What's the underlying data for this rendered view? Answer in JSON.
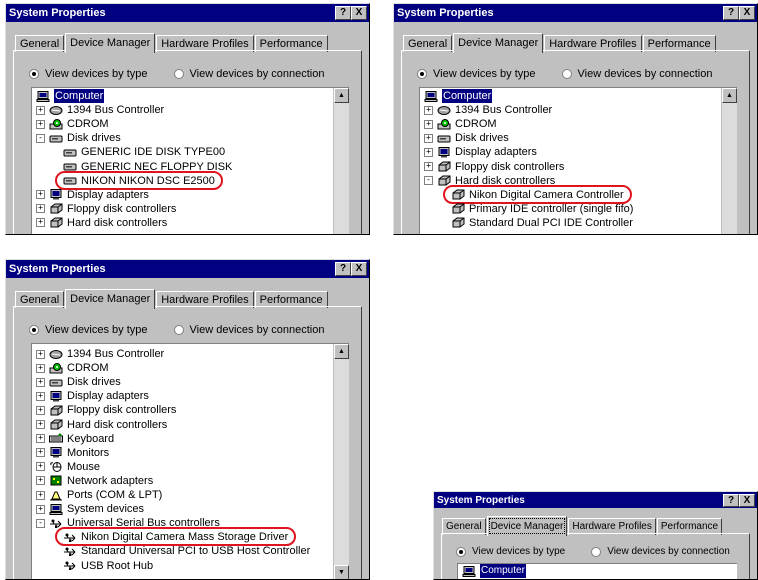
{
  "colors": {
    "titlebar": "#000080",
    "callout": "#e0141e",
    "window": "#c0c0c0"
  },
  "dialog": {
    "title": "System Properties",
    "help_label": "?",
    "close_label": "X",
    "tabs": [
      "General",
      "Device Manager",
      "Hardware Profiles",
      "Performance"
    ],
    "active_tab": "Device Manager",
    "view_by_type": "View devices by type",
    "view_by_connection": "View devices by connection"
  },
  "screens": [
    {
      "rows": [
        {
          "text": "Computer",
          "icon": "computer-icon",
          "selected": true
        },
        {
          "text": "1394 Bus Controller",
          "icon": "bus-icon",
          "toggle": "+"
        },
        {
          "text": "CDROM",
          "icon": "cdrom-icon",
          "toggle": "+"
        },
        {
          "text": "Disk drives",
          "icon": "disk-icon",
          "toggle": "-"
        },
        {
          "text": "GENERIC IDE  DISK TYPE00",
          "icon": "disk-icon"
        },
        {
          "text": "GENERIC NEC  FLOPPY DISK",
          "icon": "disk-icon"
        },
        {
          "text": "NIKON NIKON DSC E2500",
          "icon": "disk-icon",
          "circled": true
        },
        {
          "text": "Display adapters",
          "icon": "monitor-icon",
          "toggle": "+"
        },
        {
          "text": "Floppy disk controllers",
          "icon": "controller-icon",
          "toggle": "+"
        },
        {
          "text": "Hard disk controllers",
          "icon": "controller-icon",
          "toggle": "+"
        }
      ]
    },
    {
      "rows": [
        {
          "text": "Computer",
          "icon": "computer-icon",
          "selected": true
        },
        {
          "text": "1394 Bus Controller",
          "icon": "bus-icon",
          "toggle": "+"
        },
        {
          "text": "CDROM",
          "icon": "cdrom-icon",
          "toggle": "+"
        },
        {
          "text": "Disk drives",
          "icon": "disk-icon",
          "toggle": "+"
        },
        {
          "text": "Display adapters",
          "icon": "monitor-icon",
          "toggle": "+"
        },
        {
          "text": "Floppy disk controllers",
          "icon": "controller-icon",
          "toggle": "+"
        },
        {
          "text": "Hard disk controllers",
          "icon": "controller-icon",
          "toggle": "-"
        },
        {
          "text": "Nikon Digital Camera Controller",
          "icon": "controller-icon",
          "circled": true
        },
        {
          "text": "Primary IDE controller (single fifo)",
          "icon": "controller-icon"
        },
        {
          "text": "Standard Dual PCI IDE Controller",
          "icon": "controller-icon"
        }
      ]
    },
    {
      "rows": [
        {
          "text": "1394 Bus Controller",
          "icon": "bus-icon",
          "toggle": "+"
        },
        {
          "text": "CDROM",
          "icon": "cdrom-icon",
          "toggle": "+"
        },
        {
          "text": "Disk drives",
          "icon": "disk-icon",
          "toggle": "+"
        },
        {
          "text": "Display adapters",
          "icon": "monitor-icon",
          "toggle": "+"
        },
        {
          "text": "Floppy disk controllers",
          "icon": "controller-icon",
          "toggle": "+"
        },
        {
          "text": "Hard disk controllers",
          "icon": "controller-icon",
          "toggle": "+"
        },
        {
          "text": "Keyboard",
          "icon": "keyboard-icon",
          "toggle": "+"
        },
        {
          "text": "Monitors",
          "icon": "monitor-icon",
          "toggle": "+"
        },
        {
          "text": "Mouse",
          "icon": "mouse-icon",
          "toggle": "+"
        },
        {
          "text": "Network adapters",
          "icon": "network-icon",
          "toggle": "+"
        },
        {
          "text": "Ports (COM & LPT)",
          "icon": "port-icon",
          "toggle": "+"
        },
        {
          "text": "System devices",
          "icon": "computer-icon",
          "toggle": "+"
        },
        {
          "text": "Universal Serial Bus controllers",
          "icon": "usb-icon",
          "toggle": "-"
        },
        {
          "text": "Nikon Digital Camera Mass Storage Driver",
          "icon": "usb-icon",
          "circled": true
        },
        {
          "text": "Standard Universal PCI to USB Host Controller",
          "icon": "usb-icon"
        },
        {
          "text": "USB Root Hub",
          "icon": "usb-icon"
        }
      ]
    },
    {
      "rows": [
        {
          "text": "Computer",
          "icon": "computer-icon",
          "selected": true
        }
      ]
    }
  ]
}
